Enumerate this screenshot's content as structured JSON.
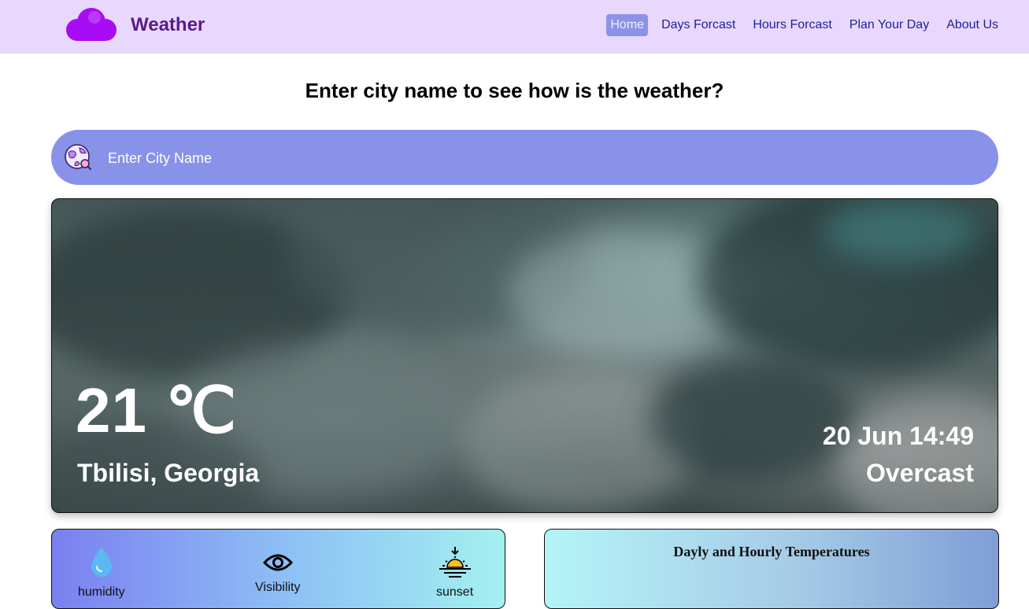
{
  "brand": {
    "name": "Weather",
    "logo_icon": "cloud-icon"
  },
  "nav": {
    "items": [
      {
        "label": "Home",
        "active": true
      },
      {
        "label": "Days Forcast",
        "active": false
      },
      {
        "label": "Hours Forcast",
        "active": false
      },
      {
        "label": "Plan Your Day",
        "active": false
      },
      {
        "label": "About Us",
        "active": false
      }
    ]
  },
  "headline": "Enter city name to see how is the weather?",
  "search": {
    "placeholder": "Enter City Name",
    "value": "",
    "icon": "globe-search-icon"
  },
  "current": {
    "temperature": "21 ℃",
    "location": "Tbilisi, Georgia",
    "datetime": "20 Jun 14:49",
    "condition": "Overcast"
  },
  "stats": [
    {
      "label": "humidity",
      "icon": "water-drop-icon"
    },
    {
      "label": "Visibility",
      "icon": "eye-icon"
    },
    {
      "label": "sunset",
      "icon": "sunset-icon"
    }
  ],
  "temps_card": {
    "title": "Dayly and Hourly Temperatures"
  },
  "colors": {
    "navbar_bg": "#e9d8fd",
    "brand": "#581c87",
    "logo": "#a80cf5",
    "nav_link": "#1e1e9e",
    "nav_active_bg": "#8b93e8",
    "search_bg": "#8892e8"
  }
}
